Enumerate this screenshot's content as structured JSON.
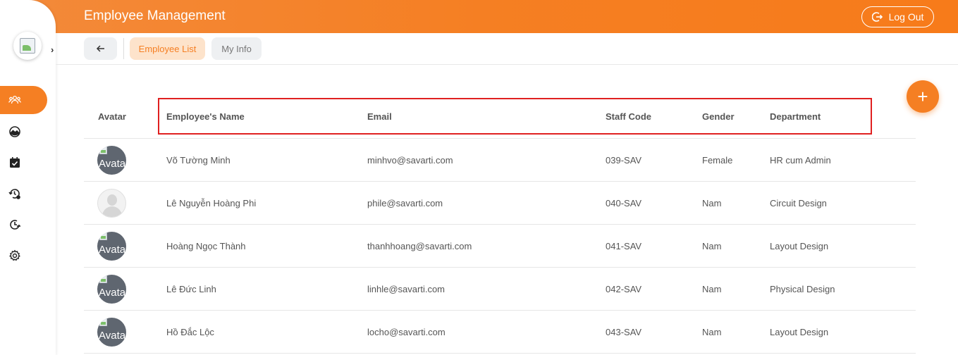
{
  "header": {
    "title": "Employee Management",
    "logout_label": "Log Out"
  },
  "sidebar": {
    "logo": "company-logo-broken-image",
    "items": [
      {
        "icon": "users-icon",
        "active": true
      },
      {
        "icon": "landscape-icon",
        "active": false
      },
      {
        "icon": "calendar-check-icon",
        "active": false
      },
      {
        "icon": "history-settings-icon",
        "active": false
      },
      {
        "icon": "clock-out-icon",
        "active": false
      },
      {
        "icon": "gear-icon",
        "active": false
      }
    ]
  },
  "toolbar": {
    "tabs": [
      {
        "label": "Employee List"
      },
      {
        "label": "My Info"
      }
    ]
  },
  "table": {
    "columns": {
      "avatar": "Avatar",
      "name": "Employee's Name",
      "email": "Email",
      "code": "Staff Code",
      "gender": "Gender",
      "department": "Department"
    },
    "avatar_alt": "Avatar",
    "rows": [
      {
        "name": "Võ Tường Minh",
        "email": "minhvo@savarti.com",
        "code": "039-SAV",
        "gender": "Female",
        "department": "HR cum Admin"
      },
      {
        "name": "Lê Nguyễn Hoàng Phi",
        "email": "phile@savarti.com",
        "code": "040-SAV",
        "gender": "Nam",
        "department": "Circuit Design"
      },
      {
        "name": "Hoàng Ngọc Thành",
        "email": "thanhhoang@savarti.com",
        "code": "041-SAV",
        "gender": "Nam",
        "department": "Layout Design"
      },
      {
        "name": "Lê Đức Linh",
        "email": "linhle@savarti.com",
        "code": "042-SAV",
        "gender": "Nam",
        "department": "Physical Design"
      },
      {
        "name": "Hồ Đắc Lộc",
        "email": "locho@savarti.com",
        "code": "043-SAV",
        "gender": "Nam",
        "department": "Layout Design"
      }
    ]
  },
  "fab_label": "+",
  "colors": {
    "accent": "#f57f23",
    "accent_light": "#fde3cb",
    "highlight": "#e02020"
  }
}
